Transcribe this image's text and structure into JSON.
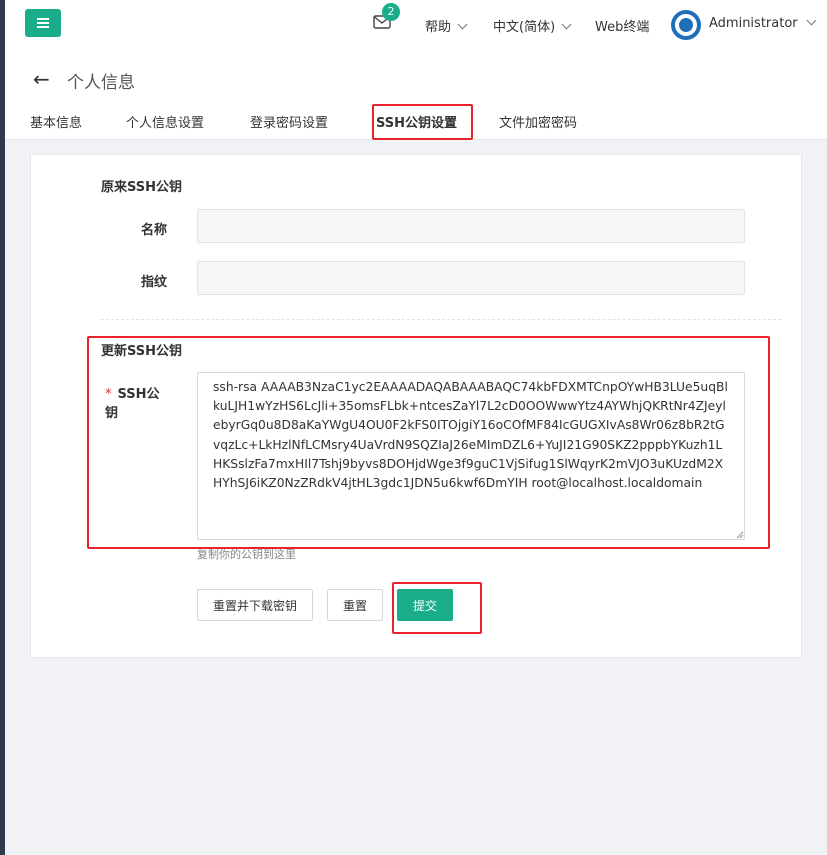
{
  "topbar": {
    "notification_count": "2",
    "help_label": "帮助",
    "language_label": "中文(简体)",
    "webterm_label": "Web终端",
    "user_label": "Administrator"
  },
  "page": {
    "title": "个人信息"
  },
  "tabs": [
    {
      "label": "基本信息"
    },
    {
      "label": "个人信息设置"
    },
    {
      "label": "登录密码设置"
    },
    {
      "label": "SSH公钥设置"
    },
    {
      "label": "文件加密密码"
    }
  ],
  "old_key_section": {
    "title": "原来SSH公钥",
    "name_label": "名称",
    "name_value": "",
    "fingerprint_label": "指纹",
    "fingerprint_value": ""
  },
  "update_section": {
    "title": "更新SSH公钥",
    "required_mark": "*",
    "ssh_label": "SSH公钥",
    "ssh_value": "ssh-rsa AAAAB3NzaC1yc2EAAAADAQABAAABAQC74kbFDXMTCnpOYwHB3LUe5uqBlkuLJH1wYzHS6LcJli+35omsFLbk+ntcesZaYl7L2cD0OOWwwYtz4AYWhjQKRtNr4ZJeylebyrGq0u8D8aKaYWgU4OU0F2kFS0ITOjgiY16oCOfMF84IcGUGXIvAs8Wr06z8bR2tGvqzLc+LkHzlNfLCMsry4UaVrdN9SQZIaJ26eMImDZL6+YuJI21G90SKZ2pppbYKuzh1LHKSslzFa7mxHIl7Tshj9byvs8DOHjdWge3f9guC1VjSifug1SlWqyrK2mVJO3uKUzdM2XHYhSJ6iKZ0NzZRdkV4jtHL3gdc1JDN5u6kwf6DmYIH root@localhost.localdomain",
    "hint": "复制你的公钥到这里"
  },
  "buttons": {
    "reset_download": "重置并下载密钥",
    "reset": "重置",
    "submit": "提交"
  },
  "colors": {
    "primary": "#1aad8c",
    "highlight": "#e8232c"
  }
}
